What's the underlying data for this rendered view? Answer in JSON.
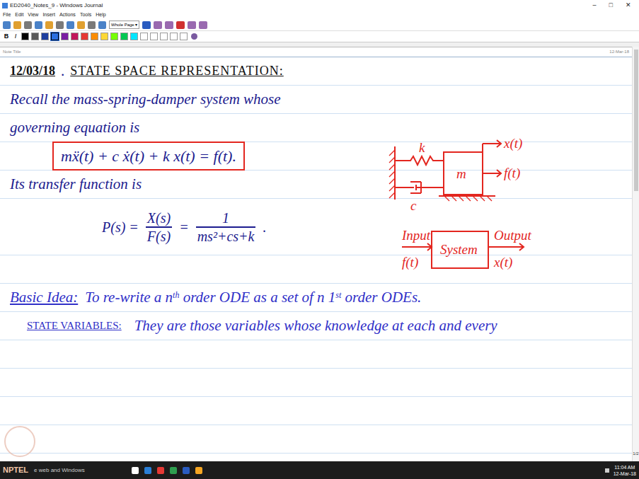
{
  "window": {
    "title": "ED2040_Notes_9 - Windows Journal",
    "controls": [
      "–",
      "□",
      "✕"
    ]
  },
  "menu": [
    "File",
    "Edit",
    "View",
    "Insert",
    "Actions",
    "Tools",
    "Help"
  ],
  "toolbar": {
    "zoom": "Whole Page",
    "format": [
      "B",
      "I"
    ],
    "swatches": [
      {
        "color": "#000000",
        "selected": false
      },
      {
        "color": "#5a5a5a",
        "selected": false
      },
      {
        "color": "#1f3f9f",
        "selected": false
      },
      {
        "color": "#2a6fe0",
        "selected": true
      },
      {
        "color": "#7b1fa2",
        "selected": false
      },
      {
        "color": "#c2185b",
        "selected": false
      },
      {
        "color": "#e53935",
        "selected": false
      },
      {
        "color": "#fb8c00",
        "selected": false
      },
      {
        "color": "#fdd835",
        "selected": false
      },
      {
        "color": "#76ff03",
        "selected": false
      },
      {
        "color": "#00c853",
        "selected": false
      },
      {
        "color": "#00e5ff",
        "selected": false
      },
      {
        "color": "#ffffff",
        "selected": false
      },
      {
        "color": "#ffffff",
        "selected": false
      },
      {
        "color": "#ffffff",
        "selected": false
      },
      {
        "color": "#ffffff",
        "selected": false
      },
      {
        "color": "#ffffff",
        "selected": false
      }
    ]
  },
  "note": {
    "title_label": "Note Title",
    "date": "12-Mar-18"
  },
  "page": {
    "heading": {
      "date": "12/03/18",
      "separator": ".",
      "title": "STATE SPACE REPRESENTATION:"
    },
    "intro": [
      "Recall the mass-spring-damper system whose",
      "governing equation is"
    ],
    "equation": "mẍ(t) + c ẋ(t) + k x(t) = f(t).",
    "tf_intro": "Its transfer function is",
    "tf": {
      "lhs": "P(s) =",
      "num1": "X(s)",
      "den1": "F(s)",
      "eq": "=",
      "num2": "1",
      "den2": "ms²+cs+k",
      "end": "."
    },
    "basic_idea": {
      "label": "Basic Idea:",
      "parts": [
        {
          "text": "To re-write a n",
          "sup": "th"
        },
        {
          "text": " order ODE as a set of n 1",
          "sup": "st"
        },
        {
          "text": " order ODEs.",
          "sup": ""
        }
      ]
    },
    "state_variables": {
      "label": "STATE VARIABLES:",
      "text": "They are those variables whose knowledge at each and every"
    },
    "diagram": {
      "k": "k",
      "m": "m",
      "c": "c",
      "x": "x(t)",
      "f": "f(t)"
    },
    "block": {
      "input": "Input",
      "input_signal": "f(t)",
      "system": "System",
      "output": "Output",
      "output_signal": "x(t)"
    }
  },
  "status": {
    "page": "1/2"
  },
  "taskbar": {
    "logo": "NPTEL",
    "search": "e web and Windows",
    "time": "11:04 AM",
    "date": "12-Mar-18"
  }
}
